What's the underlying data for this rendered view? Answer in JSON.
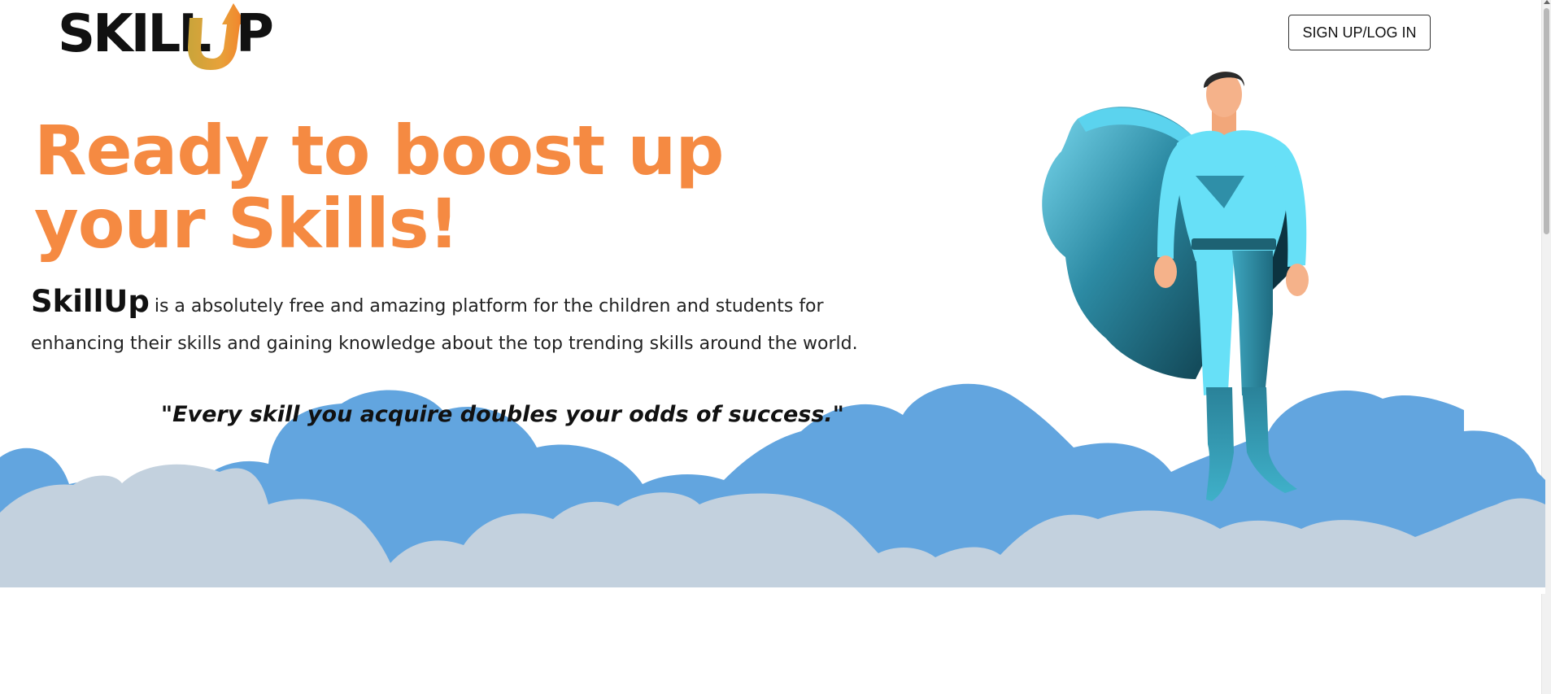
{
  "header": {
    "logo": {
      "text_left": "SKILL",
      "text_u": "U",
      "text_right": "P"
    },
    "signup_label": "SIGN UP/LOG IN"
  },
  "hero": {
    "title": "Ready to boost up your Skills!",
    "brand": "SkillUp",
    "description": "is a absolutely free and amazing platform for the children and students for enhancing their skills and gaining knowledge about the top trending skills around the world.",
    "quote": "\"Every skill you acquire doubles your odds of success.\""
  },
  "icons": {
    "logo": "skillup-logo",
    "arrow": "up-arrow-icon",
    "figure": "superhero-illustration",
    "clouds": "clouds-illustration"
  },
  "colors": {
    "accent": "#f58a42",
    "cloud_front": "#c3d1de",
    "cloud_back": "#62a5df",
    "hero_suit": "#67e0f7",
    "hero_cape": "#2f8fa8"
  }
}
